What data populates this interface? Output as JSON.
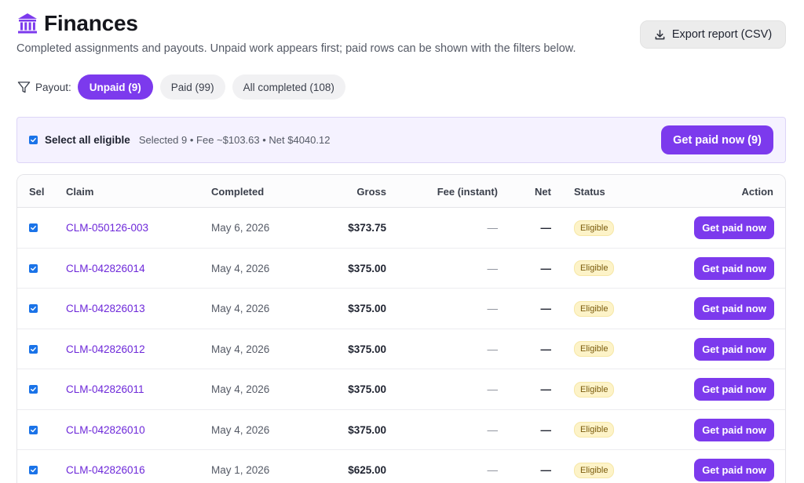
{
  "header": {
    "title": "Finances",
    "icon": "bank-icon",
    "subtitle": "Completed assignments and payouts. Unpaid work appears first; paid rows can be shown with the filters below.",
    "export_label": "Export report (CSV)"
  },
  "filters": {
    "label": "Payout:",
    "chips": [
      {
        "label": "Unpaid (9)",
        "active": true
      },
      {
        "label": "Paid (99)",
        "active": false
      },
      {
        "label": "All completed (108)",
        "active": false
      }
    ]
  },
  "selection": {
    "select_all_label": "Select all eligible",
    "checked": true,
    "summary": "Selected 9 • Fee ~$103.63 • Net $4040.12",
    "get_paid_label": "Get paid now (9)"
  },
  "table": {
    "columns": [
      "Sel",
      "Claim",
      "Completed",
      "Gross",
      "Fee (instant)",
      "Net",
      "Status",
      "Action"
    ],
    "rows": [
      {
        "claim": "CLM-050126-003",
        "completed": "May 6, 2026",
        "gross": "$373.75",
        "fee": "—",
        "net": "—",
        "status": "Eligible",
        "action": "Get paid now",
        "checked": true
      },
      {
        "claim": "CLM-042826014",
        "completed": "May 4, 2026",
        "gross": "$375.00",
        "fee": "—",
        "net": "—",
        "status": "Eligible",
        "action": "Get paid now",
        "checked": true
      },
      {
        "claim": "CLM-042826013",
        "completed": "May 4, 2026",
        "gross": "$375.00",
        "fee": "—",
        "net": "—",
        "status": "Eligible",
        "action": "Get paid now",
        "checked": true
      },
      {
        "claim": "CLM-042826012",
        "completed": "May 4, 2026",
        "gross": "$375.00",
        "fee": "—",
        "net": "—",
        "status": "Eligible",
        "action": "Get paid now",
        "checked": true
      },
      {
        "claim": "CLM-042826011",
        "completed": "May 4, 2026",
        "gross": "$375.00",
        "fee": "—",
        "net": "—",
        "status": "Eligible",
        "action": "Get paid now",
        "checked": true
      },
      {
        "claim": "CLM-042826010",
        "completed": "May 4, 2026",
        "gross": "$375.00",
        "fee": "—",
        "net": "—",
        "status": "Eligible",
        "action": "Get paid now",
        "checked": true
      },
      {
        "claim": "CLM-042826016",
        "completed": "May 1, 2026",
        "gross": "$625.00",
        "fee": "—",
        "net": "—",
        "status": "Eligible",
        "action": "Get paid now",
        "checked": true
      }
    ]
  },
  "colors": {
    "accent": "#7c3aed",
    "badge_bg": "#fdf3c8",
    "checkbox": "#1a73e8"
  }
}
